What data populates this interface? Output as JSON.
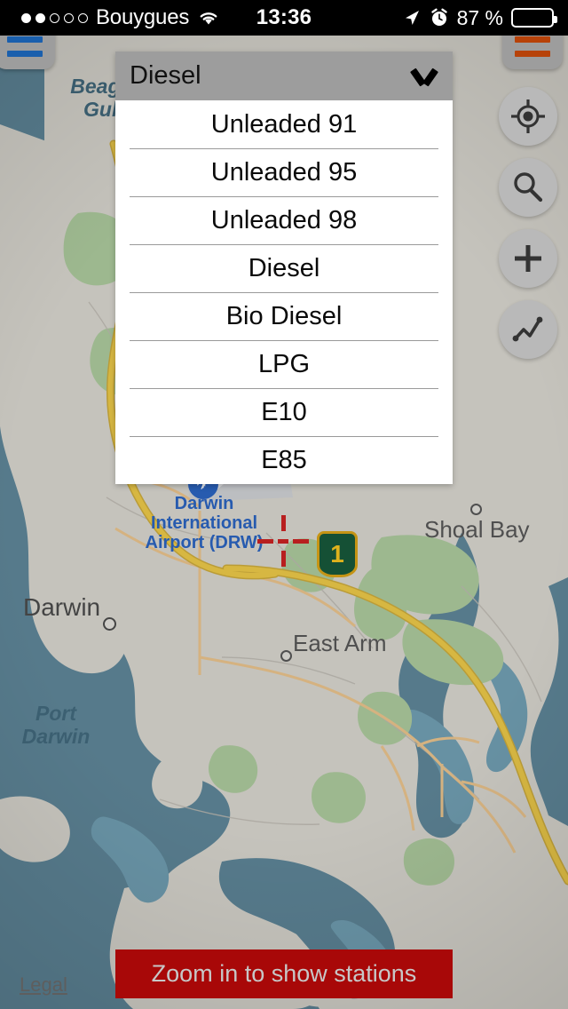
{
  "status_bar": {
    "signal_dots_total": 5,
    "signal_dots_filled": 2,
    "carrier": "Bouygues",
    "wifi_icon": "wifi-icon",
    "time": "13:36",
    "location_icon": "location-arrow-icon",
    "alarm_icon": "alarm-clock-icon",
    "battery_percent": "87 %",
    "battery_level": 87
  },
  "map_controls": {
    "menu_left": {
      "icon": "hamburger-menu-icon",
      "color": "#1a5fad"
    },
    "menu_right": {
      "icon": "hamburger-menu-icon",
      "color": "#b74209"
    },
    "locate": {
      "icon": "crosshair-locate-icon"
    },
    "search": {
      "icon": "magnifier-search-icon"
    },
    "add": {
      "icon": "plus-add-icon"
    },
    "trend": {
      "icon": "trend-chart-icon"
    }
  },
  "fuel_dropdown": {
    "selected": "Diesel",
    "chevron_icon": "chevron-down-icon",
    "expanded": true,
    "options": [
      "Unleaded 91",
      "Unleaded 95",
      "Unleaded 98",
      "Diesel",
      "Bio Diesel",
      "LPG",
      "E10",
      "E85"
    ]
  },
  "map": {
    "water_labels": [
      {
        "text": "Beagle\nGulf",
        "line1": "Beagle",
        "line2": "Gulf"
      },
      {
        "text": "Port\nDarwin",
        "line1": "Port",
        "line2": "Darwin"
      }
    ],
    "city_label": "Darwin",
    "places": [
      "Shoal Bay",
      "East Arm"
    ],
    "airport_label": {
      "line1": "Darwin",
      "line2": "International",
      "line3": "Airport (DRW)"
    },
    "highway_shield": "1",
    "colors": {
      "water": "#5d8496",
      "land": "#d4d2cb",
      "park": "#a9c69a",
      "highway": "#e8c547",
      "road": "#e6c08a",
      "marker_red": "#c62222"
    }
  },
  "bottom": {
    "zoom_banner": "Zoom in to show stations",
    "legal_link": "Legal"
  }
}
